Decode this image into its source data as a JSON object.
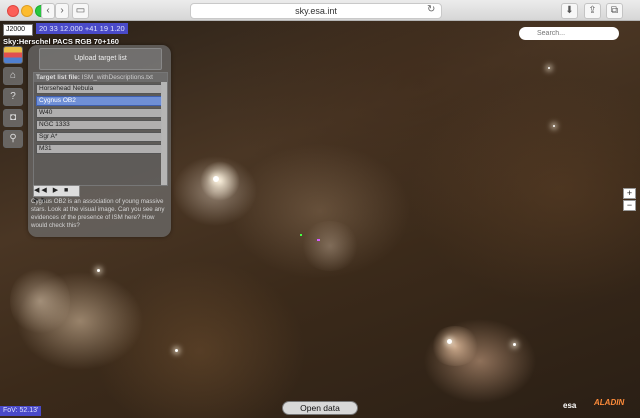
{
  "browser": {
    "url": "sky.esa.int",
    "back_icon": "chevron-left-icon",
    "forward_icon": "chevron-right-icon"
  },
  "sky": {
    "frame": "J2000",
    "coordinates": "20 33 12.000 +41 19 1.20",
    "survey": "Sky:Herschel PACS RGB 70+160",
    "search_placeholder": "Search...",
    "fov": "FoV: 52.13'",
    "open_data": "Open data",
    "esa_logo": "esa",
    "aladin_logo": "ALADIN"
  },
  "panel": {
    "upload": "Upload target list",
    "list_label": "Target list file:",
    "list_file": "ISM_withDescriptions.txt",
    "items": [
      "Horsehead Nebula",
      "Cygnus OB2",
      "W40",
      "NGC 1333",
      "Sgr A*",
      "M31"
    ],
    "selected": "Cygnus OB2",
    "controls": "◀◀ ▶ ■ ▶▶",
    "description": "Cygnus OB2 is an association of young massive stars. Look at the visual image. Can you see any evidences of the presence of ISM here? How would check this?"
  },
  "zoom": {
    "plus": "+",
    "minus": "−"
  }
}
